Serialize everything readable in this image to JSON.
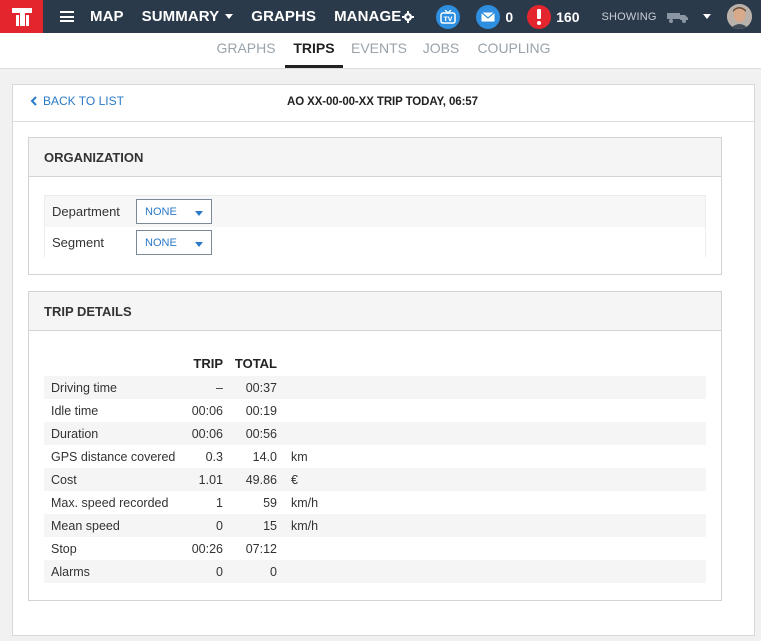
{
  "topbar": {
    "nav": [
      {
        "label": "MAP",
        "caret": false
      },
      {
        "label": "SUMMARY",
        "caret": true
      },
      {
        "label": "GRAPHS",
        "caret": false
      }
    ],
    "manage_label": "MANAGE",
    "messages_count": "0",
    "alerts_count": "160",
    "showing_label": "SHOWING",
    "colors": {
      "bar": "#2b3a4a",
      "logo": "#e3262e",
      "badge_blue": "#2e8fe0",
      "badge_red": "#e3262e"
    }
  },
  "subnav": {
    "tabs": [
      "GRAPHS",
      "TRIPS",
      "EVENTS",
      "JOBS",
      "COUPLING"
    ],
    "active": "TRIPS"
  },
  "card": {
    "back_label": "BACK TO LIST",
    "title": "AO XX-00-00-XX TRIP TODAY, 06:57"
  },
  "organization": {
    "heading": "ORGANIZATION",
    "rows": [
      {
        "label": "Department",
        "value": "NONE"
      },
      {
        "label": "Segment",
        "value": "NONE"
      }
    ]
  },
  "trip_details": {
    "heading": "TRIP DETAILS",
    "columns": [
      "TRIP",
      "TOTAL"
    ],
    "rows": [
      {
        "label": "Driving time",
        "trip": "–",
        "total": "00:37",
        "unit": ""
      },
      {
        "label": "Idle time",
        "trip": "00:06",
        "total": "00:19",
        "unit": ""
      },
      {
        "label": "Duration",
        "trip": "00:06",
        "total": "00:56",
        "unit": ""
      },
      {
        "label": "GPS distance covered",
        "trip": "0.3",
        "total": "14.0",
        "unit": "km"
      },
      {
        "label": "Cost",
        "trip": "1.01",
        "total": "49.86",
        "unit": "€"
      },
      {
        "label": "Max. speed recorded",
        "trip": "1",
        "total": "59",
        "unit": "km/h"
      },
      {
        "label": "Mean speed",
        "trip": "0",
        "total": "15",
        "unit": "km/h"
      },
      {
        "label": "Stop",
        "trip": "00:26",
        "total": "07:12",
        "unit": ""
      },
      {
        "label": "Alarms",
        "trip": "0",
        "total": "0",
        "unit": ""
      }
    ]
  }
}
